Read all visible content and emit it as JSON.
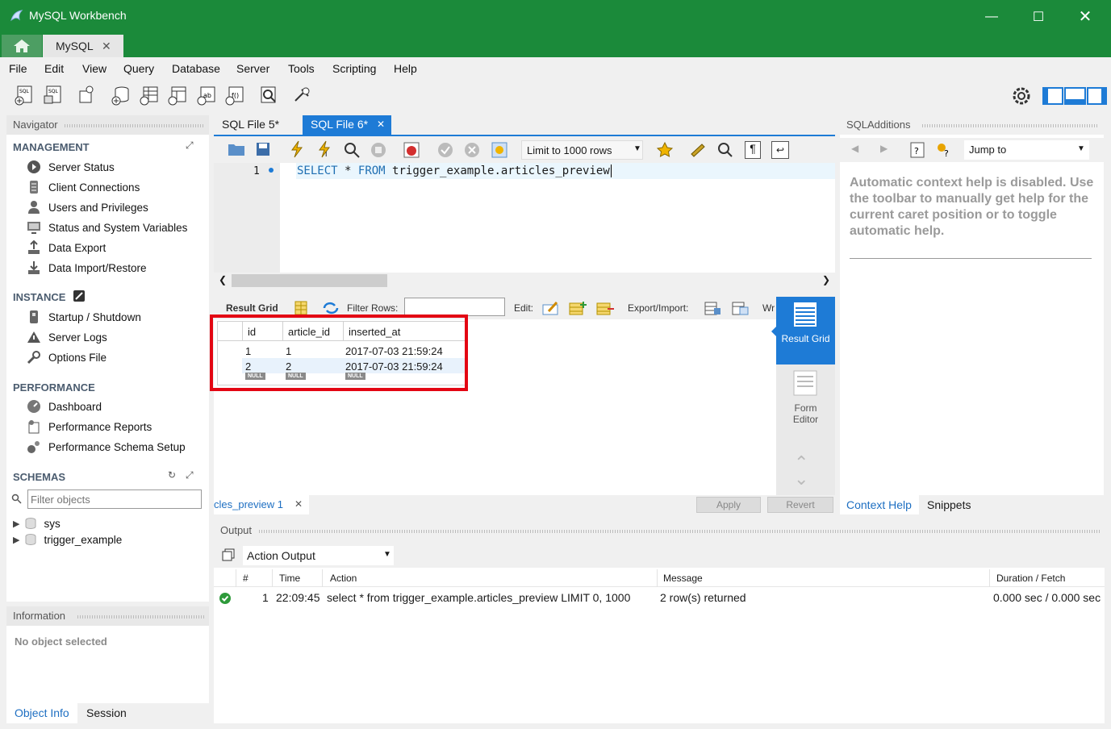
{
  "window": {
    "title": "MySQL Workbench"
  },
  "tabs": {
    "connection_tab": "MySQL"
  },
  "menu": [
    "File",
    "Edit",
    "View",
    "Query",
    "Database",
    "Server",
    "Tools",
    "Scripting",
    "Help"
  ],
  "navigator": {
    "title": "Navigator",
    "management": {
      "header": "MANAGEMENT",
      "items": [
        "Server Status",
        "Client Connections",
        "Users and Privileges",
        "Status and System Variables",
        "Data Export",
        "Data Import/Restore"
      ]
    },
    "instance": {
      "header": "INSTANCE",
      "items": [
        "Startup / Shutdown",
        "Server Logs",
        "Options File"
      ]
    },
    "performance": {
      "header": "PERFORMANCE",
      "items": [
        "Dashboard",
        "Performance Reports",
        "Performance Schema Setup"
      ]
    },
    "schemas": {
      "header": "SCHEMAS",
      "filter_placeholder": "Filter objects",
      "items": [
        "sys",
        "trigger_example"
      ]
    }
  },
  "information": {
    "title": "Information",
    "empty_text": "No object selected",
    "tabs": [
      "Object Info",
      "Session"
    ]
  },
  "editor": {
    "tabs": [
      "SQL File 5*",
      "SQL File 6*"
    ],
    "limit_label": "Limit to 1000 rows",
    "line_number": "1",
    "query": {
      "kw1": "SELECT",
      "star": "*",
      "kw2": "FROM",
      "rest": "trigger_example.articles_preview"
    }
  },
  "result": {
    "toolbar": {
      "result_grid": "Result Grid",
      "filter_rows": "Filter Rows:",
      "edit": "Edit:",
      "export_import": "Export/Import:",
      "wrap": "Wr"
    },
    "columns": [
      "id",
      "article_id",
      "inserted_at"
    ],
    "rows": [
      {
        "id": "1",
        "article_id": "1",
        "inserted_at": "2017-07-03 21:59:24"
      },
      {
        "id": "2",
        "article_id": "2",
        "inserted_at": "2017-07-03 21:59:24"
      }
    ],
    "null_label": "NULL",
    "side": {
      "result_grid": "Result Grid",
      "form_editor": "Form Editor"
    },
    "tab_label": "cles_preview 1",
    "apply": "Apply",
    "revert": "Revert",
    "highlight_color": "#e30613"
  },
  "sql_additions": {
    "title": "SQLAdditions",
    "jump_to": "Jump to",
    "help_text": "Automatic context help is disabled. Use the toolbar to manually get help for the current caret position or to toggle automatic help.",
    "tabs": [
      "Context Help",
      "Snippets"
    ]
  },
  "output": {
    "title": "Output",
    "selector": "Action Output",
    "columns": [
      "#",
      "Time",
      "Action",
      "Message",
      "Duration / Fetch"
    ],
    "rows": [
      {
        "num": "1",
        "time": "22:09:45",
        "action": "select * from trigger_example.articles_preview LIMIT 0, 1000",
        "message": "2 row(s) returned",
        "duration": "0.000 sec / 0.000 sec"
      }
    ]
  },
  "colors": {
    "title_bar": "#1b8a3a",
    "accent_blue": "#1e7bd6",
    "keyword": "#1f6fb2"
  }
}
